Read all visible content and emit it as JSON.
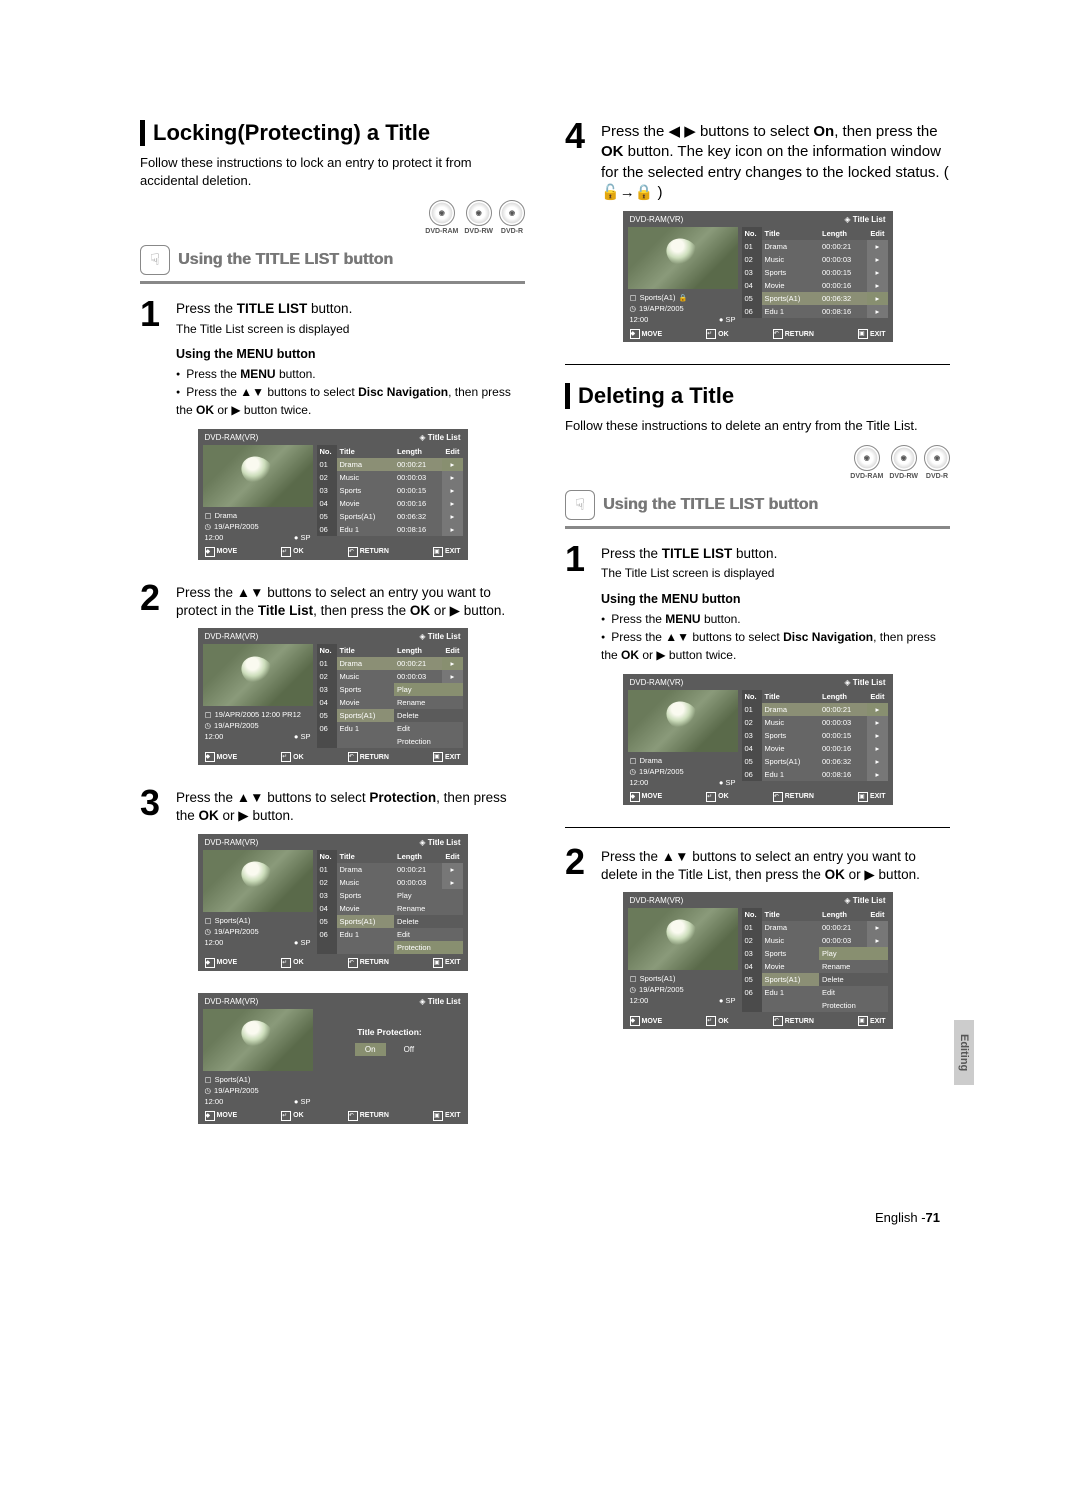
{
  "leftSection": {
    "title": "Locking(Protecting) a Title",
    "intro": "Follow these instructions to lock an entry to protect it from accidental deletion.",
    "discBadges": [
      "DVD-RAM",
      "DVD-RW",
      "DVD-R"
    ],
    "subheading": "Using the TITLE LIST button",
    "step1": {
      "line1a": "Press the ",
      "line1b": "TITLE LIST",
      "line1c": " button.",
      "sub": "The Title List screen is displayed"
    },
    "menuTitle": "Using the MENU button",
    "bullets": {
      "b1a": "Press the ",
      "b1b": "MENU",
      "b1c": " button.",
      "b2a": "Press the ",
      "b2b": " buttons to select ",
      "b2c": "Disc Navigation",
      "b2d": ", then press the ",
      "b2e": "OK",
      "b2f": " or ",
      "b2g": " button twice."
    },
    "step2": {
      "a": "Press the ",
      "b": " buttons to select an entry you want to protect in the ",
      "c": "Title List",
      "d": ", then press the ",
      "e": "OK",
      "f": " or ",
      "g": " button."
    },
    "step3": {
      "a": "Press the ",
      "b": " buttons to select ",
      "c": "Protection",
      "d": ", then press the ",
      "e": "OK",
      "f": " or ",
      "g": " button."
    }
  },
  "rightTop": {
    "step4": {
      "a": "Press the ",
      "b": " buttons to select ",
      "c": "On",
      "d": ", then press the ",
      "e": "OK",
      "f": " button. The key icon on the information window for the selected entry changes to the locked status. (",
      "g": ")"
    }
  },
  "rightSection": {
    "title": "Deleting a Title",
    "intro": "Follow these instructions to delete an entry from the Title List.",
    "discBadges": [
      "DVD-RAM",
      "DVD-RW",
      "DVD-R"
    ],
    "subheading": "Using the TITLE LIST button",
    "step1": {
      "line1a": "Press the ",
      "line1b": "TITLE LIST",
      "line1c": " button.",
      "sub": "The Title List screen is displayed"
    },
    "menuTitle": "Using the MENU button",
    "bullets": {
      "b1a": "Press the ",
      "b1b": "MENU",
      "b1c": " button.",
      "b2a": "Press the ",
      "b2b": " buttons to select ",
      "b2c": "Disc Navigation",
      "b2d": ", then press the ",
      "b2e": "OK",
      "b2f": " or ",
      "b2g": " button twice."
    },
    "step2": {
      "a": "Press the ",
      "b": " buttons to select an entry you want to delete in the Title List, then press the ",
      "c": "OK",
      "d": " or ",
      "e": " button."
    }
  },
  "ui": {
    "header": "DVD-RAM(VR)",
    "titleListLabel": "Title List",
    "cols": {
      "no": "No.",
      "title": "Title",
      "length": "Length",
      "edit": "Edit"
    },
    "rows": [
      {
        "no": "01",
        "title": "Drama",
        "len": "00:00:21"
      },
      {
        "no": "02",
        "title": "Music",
        "len": "00:00:03"
      },
      {
        "no": "03",
        "title": "Sports",
        "len": "00:00:15"
      },
      {
        "no": "04",
        "title": "Movie",
        "len": "00:00:16"
      },
      {
        "no": "05",
        "title": "Sports(A1)",
        "len": "00:06:32"
      },
      {
        "no": "06",
        "title": "Edu 1",
        "len": "00:08:16"
      }
    ],
    "infoA": {
      "line1": "Drama",
      "line2": "19/APR/2005",
      "time": "12:00",
      "mode": "SP"
    },
    "infoB": {
      "line1": "19/APR/2005 12:00 PR12",
      "line2": "19/APR/2005",
      "time": "12:00",
      "mode": "SP"
    },
    "infoC": {
      "line1": "Sports(A1)",
      "line2": "19/APR/2005",
      "time": "12:00",
      "mode": "SP"
    },
    "context": [
      "Play",
      "Rename",
      "Delete",
      "Edit",
      "Protection"
    ],
    "contextDrama": {
      "r1": "00:00:21",
      "r2": "00:00:03"
    },
    "protectLabel": "Title Protection:",
    "on": "On",
    "off": "Off",
    "footer": {
      "move": "MOVE",
      "ok": "OK",
      "ret": "RETURN",
      "exit": "EXIT"
    }
  },
  "sidetab": "Editing",
  "pageFooter": {
    "lang": "English -",
    "num": "71"
  },
  "glyph": {
    "upDown": "▲▼",
    "leftRight": "◀ ▶",
    "right": "▶",
    "rightTri": "▸",
    "diamond": "◈",
    "unlock": "🔓",
    "lock": "🔒",
    "arrow": "→",
    "handIcon": "☟",
    "discIcon": "◉",
    "disc": "●",
    "folder": "▢",
    "clock": "◷"
  }
}
